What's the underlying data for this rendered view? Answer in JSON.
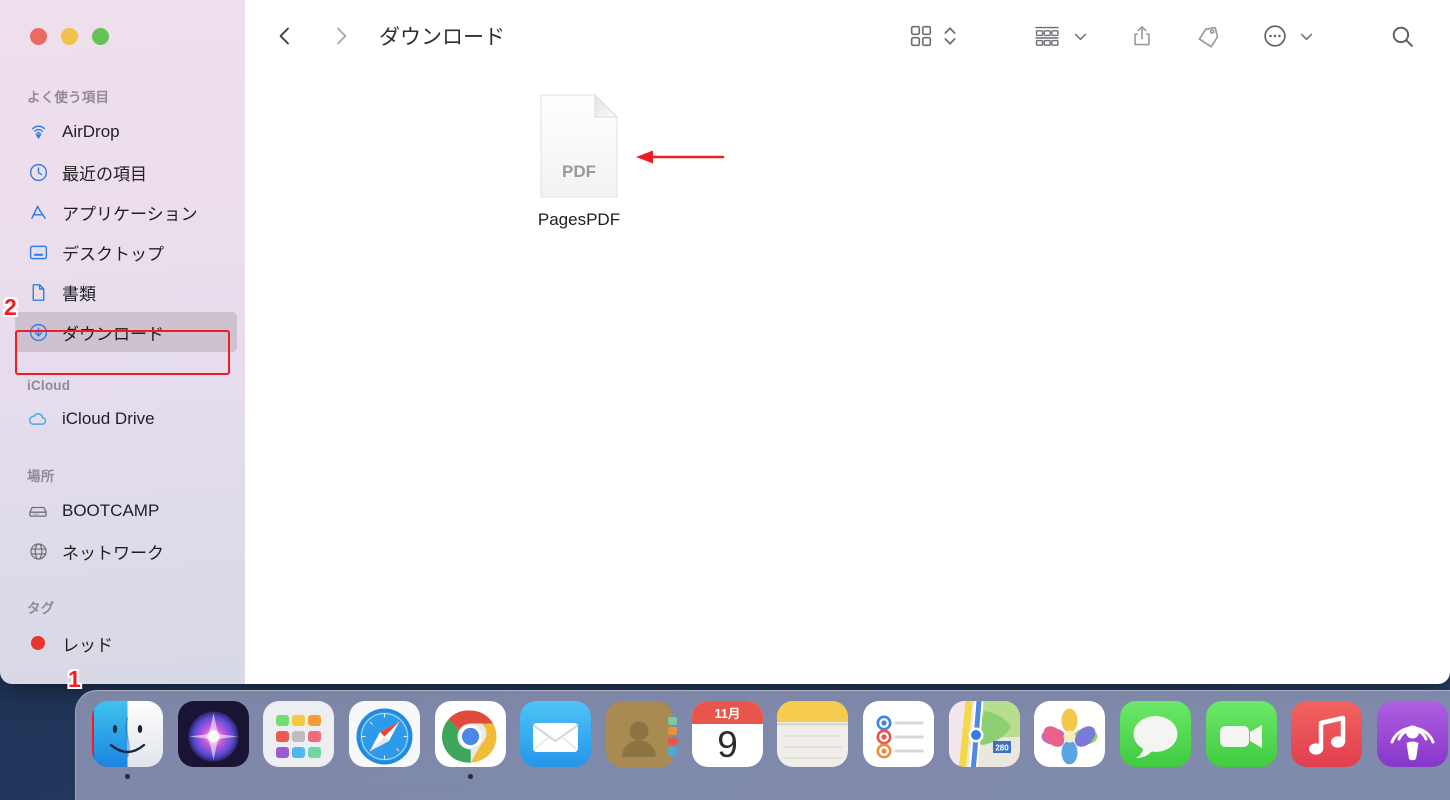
{
  "window": {
    "title": "ダウンロード",
    "traffic_lights": [
      {
        "name": "close",
        "color": "#ec6a5f"
      },
      {
        "name": "minimize",
        "color": "#f0c14b"
      },
      {
        "name": "zoom",
        "color": "#61c454"
      }
    ]
  },
  "toolbar": {
    "back_label": "戻る",
    "forward_label": "進む",
    "view_label": "表示",
    "group_label": "グループ分け",
    "share_label": "共有",
    "tag_label": "タグ",
    "more_label": "その他",
    "search_label": "検索"
  },
  "sidebar": {
    "sections": [
      {
        "title": "よく使う項目",
        "items": [
          {
            "label": "AirDrop",
            "icon": "airdrop-icon",
            "selected": false
          },
          {
            "label": "最近の項目",
            "icon": "clock-icon",
            "selected": false
          },
          {
            "label": "アプリケーション",
            "icon": "applications-icon",
            "selected": false
          },
          {
            "label": "デスクトップ",
            "icon": "desktop-icon",
            "selected": false
          },
          {
            "label": "書類",
            "icon": "document-icon",
            "selected": false
          },
          {
            "label": "ダウンロード",
            "icon": "download-icon",
            "selected": true
          }
        ]
      },
      {
        "title": "iCloud",
        "items": [
          {
            "label": "iCloud Drive",
            "icon": "cloud-icon",
            "selected": false
          }
        ]
      },
      {
        "title": "場所",
        "items": [
          {
            "label": "BOOTCAMP",
            "icon": "harddisk-icon",
            "selected": false
          },
          {
            "label": "ネットワーク",
            "icon": "globe-icon",
            "selected": false
          }
        ]
      },
      {
        "title": "タグ",
        "items": [
          {
            "label": "レッド",
            "icon": "red-dot-icon",
            "selected": false
          }
        ]
      }
    ]
  },
  "files": [
    {
      "name": "PagesPDF",
      "type": "PDF",
      "badge_text": "PDF"
    }
  ],
  "annotations": {
    "badge_1": "1",
    "badge_2": "2",
    "badge_color": "#ee1c25",
    "arrow_color": "#ee1c25",
    "highlight_border_color": "#ee1c25"
  },
  "dock": {
    "items": [
      {
        "label": "Finder",
        "icon": "finder-icon",
        "running": true,
        "highlighted": true
      },
      {
        "label": "Siri",
        "icon": "siri-icon",
        "running": false,
        "highlighted": false
      },
      {
        "label": "Launchpad",
        "icon": "launchpad-icon",
        "running": false,
        "highlighted": false
      },
      {
        "label": "Safari",
        "icon": "safari-icon",
        "running": false,
        "highlighted": false
      },
      {
        "label": "Google Chrome",
        "icon": "chrome-icon",
        "running": true,
        "highlighted": false
      },
      {
        "label": "メール",
        "icon": "mail-icon",
        "running": false,
        "highlighted": false
      },
      {
        "label": "連絡先",
        "icon": "contacts-icon",
        "running": false,
        "highlighted": false
      },
      {
        "label": "カレンダー",
        "icon": "calendar-icon",
        "running": false,
        "highlighted": false,
        "month": "11月",
        "day": "9"
      },
      {
        "label": "メモ",
        "icon": "notes-icon",
        "running": false,
        "highlighted": false
      },
      {
        "label": "リマインダー",
        "icon": "reminders-icon",
        "running": false,
        "highlighted": false
      },
      {
        "label": "マップ",
        "icon": "maps-icon",
        "running": false,
        "highlighted": false,
        "highway": "280"
      },
      {
        "label": "写真",
        "icon": "photos-icon",
        "running": false,
        "highlighted": false
      },
      {
        "label": "メッセージ",
        "icon": "messages-icon",
        "running": false,
        "highlighted": false
      },
      {
        "label": "FaceTime",
        "icon": "facetime-icon",
        "running": false,
        "highlighted": false
      },
      {
        "label": "ミュージック",
        "icon": "music-icon",
        "running": false,
        "highlighted": false
      },
      {
        "label": "Podcast",
        "icon": "podcasts-icon",
        "running": false,
        "highlighted": false
      }
    ]
  }
}
